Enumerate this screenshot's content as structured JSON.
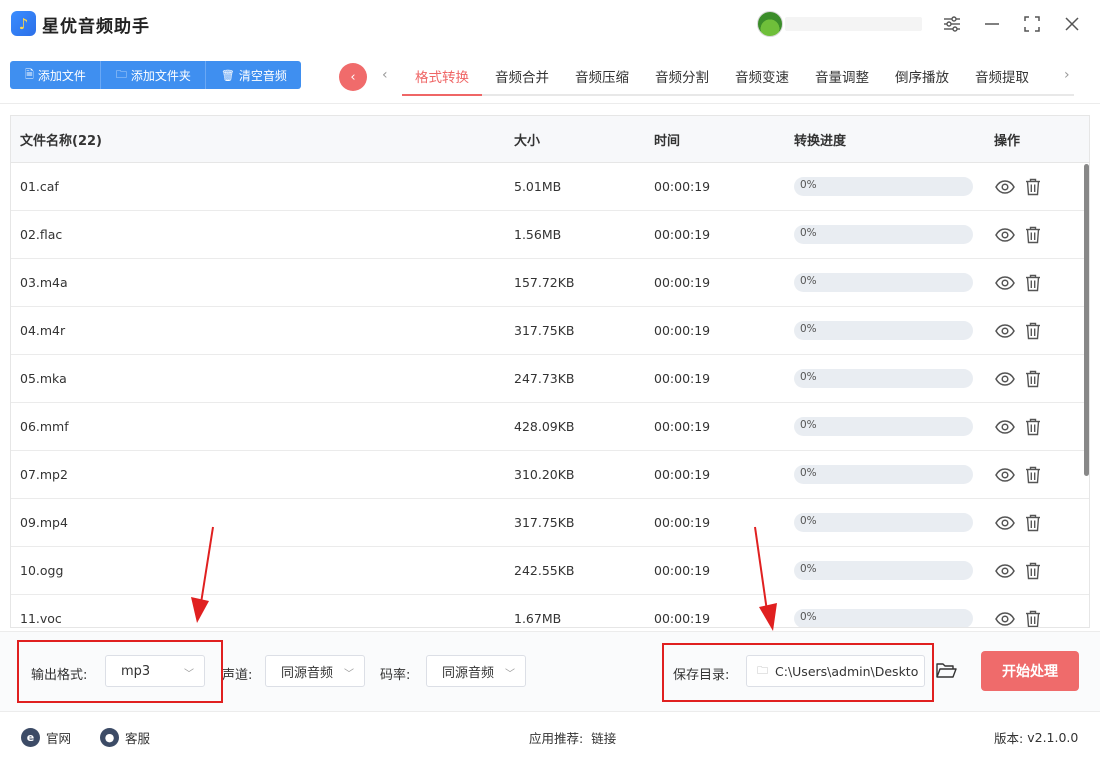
{
  "app": {
    "title": "星优音频助手",
    "logo_glyph": "♪"
  },
  "window_controls": [
    "settings-icon",
    "minimize-icon",
    "maximize-icon",
    "close-icon"
  ],
  "toolbar": {
    "add_file": "添加文件",
    "add_folder": "添加文件夹",
    "clear_audio": "清空音频"
  },
  "tabs": [
    {
      "label": "格式转换",
      "active": true
    },
    {
      "label": "音频合并",
      "active": false
    },
    {
      "label": "音频压缩",
      "active": false
    },
    {
      "label": "音频分割",
      "active": false
    },
    {
      "label": "音频变速",
      "active": false
    },
    {
      "label": "音量调整",
      "active": false
    },
    {
      "label": "倒序播放",
      "active": false
    },
    {
      "label": "音频提取",
      "active": false
    }
  ],
  "table": {
    "headers": {
      "name": "文件名称(22)",
      "size": "大小",
      "time": "时间",
      "progress": "转换进度",
      "ops": "操作"
    },
    "rows": [
      {
        "name": "01.caf",
        "size": "5.01MB",
        "time": "00:00:19",
        "progress": "0%"
      },
      {
        "name": "02.flac",
        "size": "1.56MB",
        "time": "00:00:19",
        "progress": "0%"
      },
      {
        "name": "03.m4a",
        "size": "157.72KB",
        "time": "00:00:19",
        "progress": "0%"
      },
      {
        "name": "04.m4r",
        "size": "317.75KB",
        "time": "00:00:19",
        "progress": "0%"
      },
      {
        "name": "05.mka",
        "size": "247.73KB",
        "time": "00:00:19",
        "progress": "0%"
      },
      {
        "name": "06.mmf",
        "size": "428.09KB",
        "time": "00:00:19",
        "progress": "0%"
      },
      {
        "name": "07.mp2",
        "size": "310.20KB",
        "time": "00:00:19",
        "progress": "0%"
      },
      {
        "name": "09.mp4",
        "size": "317.75KB",
        "time": "00:00:19",
        "progress": "0%"
      },
      {
        "name": "10.ogg",
        "size": "242.55KB",
        "time": "00:00:19",
        "progress": "0%"
      },
      {
        "name": "11.voc",
        "size": "1.67MB",
        "time": "00:00:19",
        "progress": "0%"
      }
    ]
  },
  "settings": {
    "output_format_label": "输出格式:",
    "output_format_value": "mp3",
    "channel_label": "声道:",
    "channel_value": "同源音频",
    "bitrate_label": "码率:",
    "bitrate_value": "同源音频",
    "save_dir_label": "保存目录:",
    "save_dir_value": "C:\\Users\\admin\\Deskto",
    "start_button": "开始处理"
  },
  "footer": {
    "website": "官网",
    "support": "客服",
    "recommend_label": "应用推荐:",
    "recommend_link": "链接",
    "version_label": "版本:",
    "version_value": "v2.1.0.0"
  },
  "colors": {
    "primary": "#3f8ff0",
    "accent": "#ef6666",
    "annotation": "#e02020"
  }
}
